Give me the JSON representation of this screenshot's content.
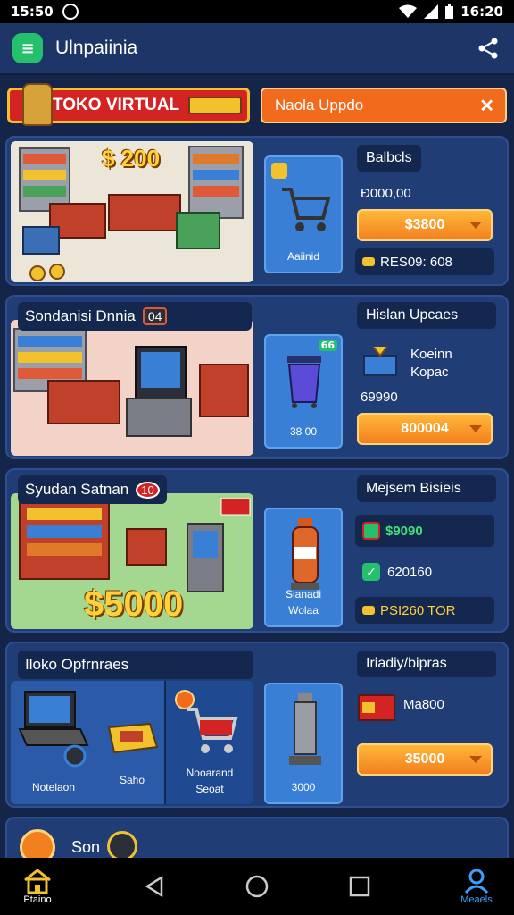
{
  "status_bar": {
    "time_left": "15:50",
    "time_right": "16:20"
  },
  "app_bar": {
    "title": "Ulnpaiinia",
    "logo_icon": "store-app-icon",
    "share_icon": "share-icon"
  },
  "banner": {
    "title": "TOKO VIRTUAL"
  },
  "notice": {
    "text": "Naola Uppdo",
    "close_icon": "close-icon"
  },
  "cards": [
    {
      "scene_price": "$ 200",
      "item_label": "Aaiinid",
      "right_title": "Balbcls",
      "balance": "Ð000,00",
      "buy_label": "$3800",
      "info": "RES09: 608"
    },
    {
      "title": "Sondanisi Dnnia",
      "title_badge": "04",
      "right_title": "Hislan Upcaes",
      "item_label": "38 00",
      "item_badge": "66",
      "side_name_1": "Koeinn",
      "side_name_2": "Kopac",
      "side_price": "69990",
      "buy_label": "800004"
    },
    {
      "title": "Syudan Satnan",
      "title_badge": "10",
      "scene_money": "$5000",
      "item_label_1": "Sianadi",
      "item_label_2": "Wolaa",
      "right_title": "Mejsem Bisieis",
      "price_green": "$9090",
      "price_check": "620160",
      "info": "PSI260 TOR"
    },
    {
      "title": "Iloko Opfrnraes",
      "right_title": "Iriadiy/bipras",
      "label_laptop": "Notelaon",
      "label_card": "Saho",
      "label_cart_1": "Nooarand",
      "label_cart_2": "Seoat",
      "item_label": "3000",
      "side_price": "Ma800",
      "buy_label": "35000"
    }
  ],
  "partial_card": {
    "title": "Son"
  },
  "nav": {
    "home_label": "Ptaino",
    "menu_label": "Meaels"
  },
  "colors": {
    "background": "#15254a",
    "card": "#203d75",
    "accent_orange": "#f2801e",
    "banner_red": "#d42323",
    "nav_active": "#3aa0ff"
  }
}
